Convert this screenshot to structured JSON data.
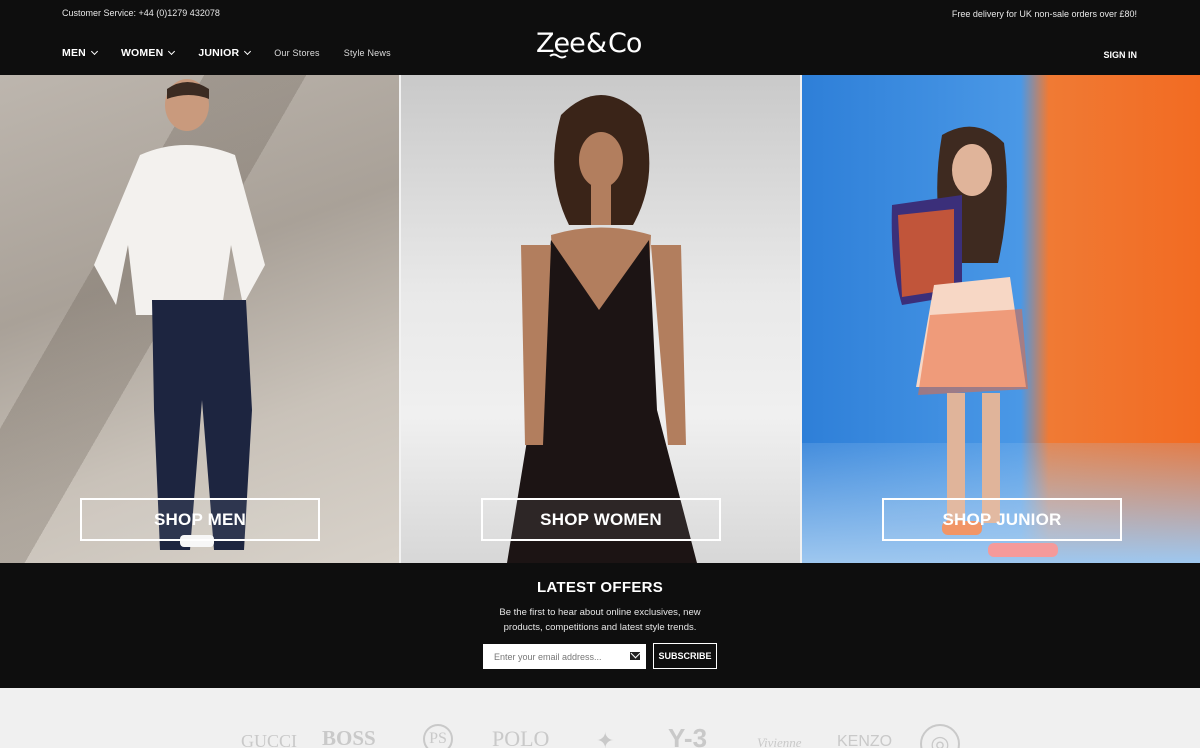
{
  "topbar": {
    "customer_service": "Customer Service: +44 (0)1279 432078",
    "delivery": "Free delivery for UK non-sale orders over £80!"
  },
  "nav": {
    "items": [
      {
        "label": "MEN",
        "dropdown": true
      },
      {
        "label": "WOMEN",
        "dropdown": true
      },
      {
        "label": "JUNIOR",
        "dropdown": true
      },
      {
        "label": "Our Stores",
        "dropdown": false
      },
      {
        "label": "Style News",
        "dropdown": false
      }
    ],
    "signin": "SIGN IN"
  },
  "logo": "Zee & Co",
  "hero": {
    "men": {
      "button": "SHOP MEN"
    },
    "women": {
      "button": "SHOP WOMEN"
    },
    "junior": {
      "button": "SHOP JUNIOR"
    }
  },
  "offers": {
    "title": "LATEST OFFERS",
    "text": "Be the first to hear about online exclusives, new products, competitions and latest style trends.",
    "email_placeholder": "Enter your email address...",
    "subscribe": "SUBSCRIBE"
  },
  "brands": [
    "GUCCI",
    "BOSS",
    "PS",
    "POLO",
    "✦",
    "Y-3",
    "Vivienne",
    "KENZO",
    "◎"
  ],
  "colors": {
    "header_bg": "#0e0e0e",
    "junior_blue": "#2e7fd8",
    "junior_orange": "#f26b22"
  }
}
